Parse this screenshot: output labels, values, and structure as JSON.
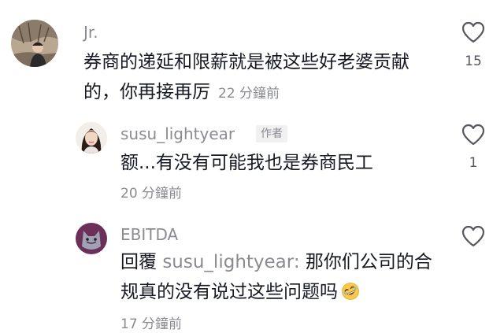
{
  "comments": [
    {
      "username": "Jr.",
      "text": "券商的递延和限薪就是被这些好老婆贡献的，你再接再厉",
      "text_line1": "券商的递延和限薪就是被这些好老婆贡献",
      "text_line2": "的，你再接再厉",
      "time": "22 分鐘前",
      "likes": "15",
      "avatar_icon": "photo-avatar"
    },
    {
      "username": "susu_lightyear",
      "badge": "作者",
      "text": "额...有没有可能我也是券商民工",
      "time": "20 分鐘前",
      "likes": "1",
      "avatar_icon": "photo-avatar"
    },
    {
      "username": "EBITDA",
      "reply_prefix": "回覆",
      "reply_to": "susu_lightyear:",
      "text_line1": "那你们公司的合",
      "text_line2": "规真的没有说过这些问题吗",
      "time": "17 分鐘前",
      "emoji": "rofl-emoji",
      "avatar_icon": "cat-avatar"
    }
  ],
  "colors": {
    "text": "#161823",
    "muted": "#8a8b91",
    "badge_bg": "#f1f1f2",
    "icon": "#555760"
  }
}
